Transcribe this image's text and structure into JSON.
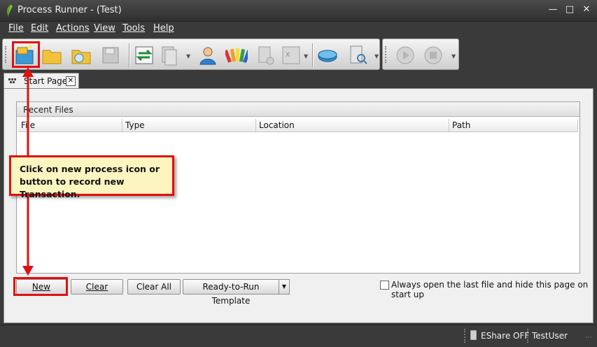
{
  "window": {
    "title": "Process Runner - (Test)"
  },
  "menu": {
    "items": [
      {
        "label": "File"
      },
      {
        "label": "Edit"
      },
      {
        "label": "Actions"
      },
      {
        "label": "View"
      },
      {
        "label": "Tools"
      },
      {
        "label": "Help"
      }
    ]
  },
  "toolbar": {
    "icons": [
      "new-process-icon",
      "open-folder-icon",
      "recent-folder-icon",
      "save-icon",
      "transfer-icon",
      "documents-icon",
      "user-icon",
      "color-palette-icon",
      "add-document-icon",
      "excel-icon",
      "database-icon",
      "search-report-icon",
      "play-icon",
      "stop-icon"
    ]
  },
  "tabs": [
    {
      "label": "Start Page"
    }
  ],
  "recent_files": {
    "title": "Recent Files",
    "columns": [
      "File",
      "Type",
      "Location",
      "Path"
    ],
    "rows": []
  },
  "buttons": {
    "new": "New",
    "clear": "Clear",
    "clear_all": "Clear All",
    "template": "Ready-to-Run Template"
  },
  "startup_option": {
    "label": "Always open the last file and hide this page on start up",
    "checked": false
  },
  "status": {
    "eshare": "EShare OFF",
    "user": "TestUser"
  },
  "annotation": {
    "text": "Click on new process icon or button to record new Transaction.",
    "color": "#e01010"
  },
  "colors": {
    "chrome": "#3a3a3a",
    "pane": "#f0f0f0",
    "highlight": "#e01010",
    "callout_bg": "#fdf5c0"
  }
}
